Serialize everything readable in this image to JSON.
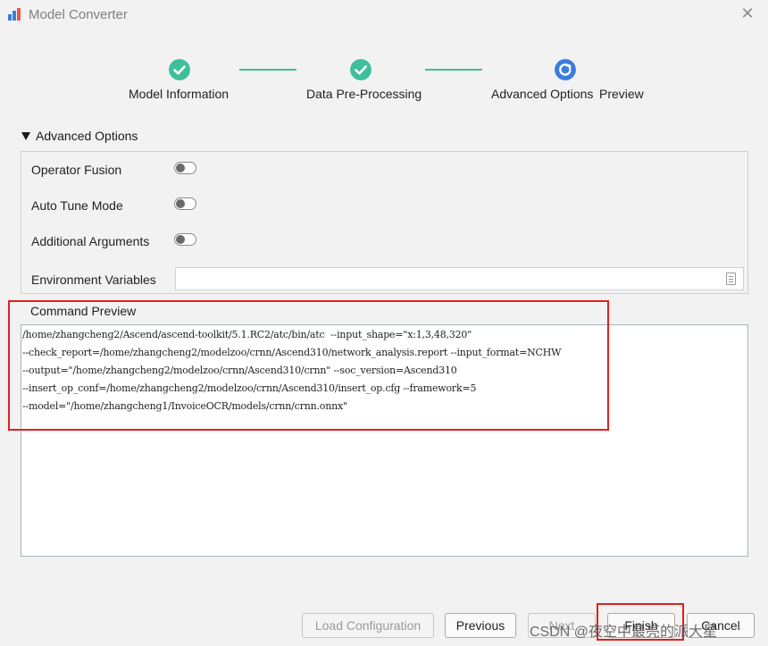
{
  "window": {
    "title": "Model Converter"
  },
  "stepper": {
    "steps": [
      {
        "label": "Model Information",
        "state": "done"
      },
      {
        "label": "Data Pre-Processing",
        "state": "done"
      },
      {
        "label": "Advanced Options",
        "state": "current"
      },
      {
        "label": "Preview",
        "state": "pending"
      }
    ]
  },
  "advanced": {
    "header": "Advanced Options",
    "operator_fusion": {
      "label": "Operator Fusion",
      "on": false
    },
    "auto_tune": {
      "label": "Auto Tune Mode",
      "on": false
    },
    "additional_args": {
      "label": "Additional Arguments",
      "on": false
    },
    "env_vars": {
      "label": "Environment Variables",
      "value": ""
    }
  },
  "command_preview": {
    "label": "Command Preview",
    "lines": [
      "/home/zhangcheng2/Ascend/ascend-toolkit/5.1.RC2/atc/bin/atc  --input_shape=\"x:1,3,48,320\"",
      "--check_report=/home/zhangcheng2/modelzoo/crnn/Ascend310/network_analysis.report --input_format=NCHW",
      "--output=\"/home/zhangcheng2/modelzoo/crnn/Ascend310/crnn\" --soc_version=Ascend310",
      "--insert_op_conf=/home/zhangcheng2/modelzoo/crnn/Ascend310/insert_op.cfg --framework=5",
      "--model=\"/home/zhangcheng1/InvoiceOCR/models/crnn/crnn.onnx\""
    ]
  },
  "buttons": {
    "load": "Load Configuration",
    "previous": "Previous",
    "next": "Next",
    "finish": "Finish",
    "cancel": "Cancel"
  },
  "watermark": "CSDN @夜空中最亮的派大星",
  "colors": {
    "done": "#3fbf9c",
    "current": "#3b7ddd",
    "highlight": "#e02020"
  }
}
